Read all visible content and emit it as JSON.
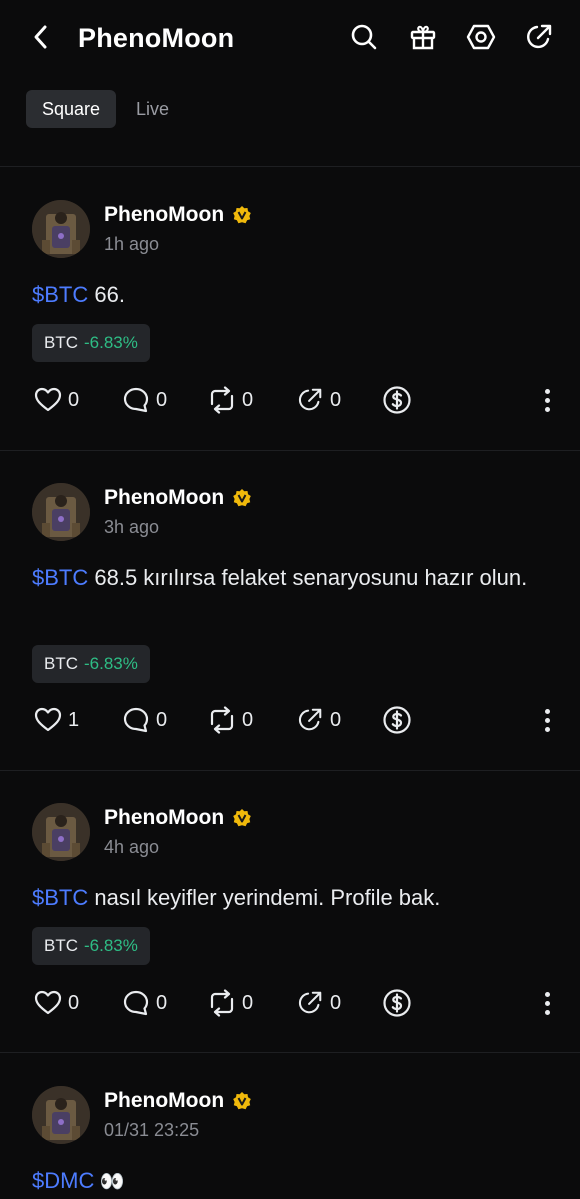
{
  "header": {
    "title": "PhenoMoon",
    "back_icon": "chevron-left-icon",
    "icons": [
      "search-icon",
      "gift-icon",
      "settings-icon",
      "share-icon"
    ]
  },
  "tabs": [
    {
      "label": "Square",
      "active": true
    },
    {
      "label": "Live",
      "active": false
    }
  ],
  "colors": {
    "background": "#0b0b0c",
    "cashtag": "#4d7cff",
    "positive_pct": "#2ebd85",
    "verified": "#f0b90b"
  },
  "posts": [
    {
      "author": "PhenoMoon",
      "time": "1h ago",
      "cashtag": "$BTC",
      "text": " 66.",
      "chip": {
        "symbol": "BTC",
        "change": "-6.83%"
      },
      "stats": {
        "likes": "0",
        "comments": "0",
        "reposts": "0",
        "shares": "0"
      }
    },
    {
      "author": "PhenoMoon",
      "time": "3h ago",
      "cashtag": "$BTC",
      "text": " 68.5 kırılırsa felaket senaryosunu hazır olun.",
      "chip": {
        "symbol": "BTC",
        "change": "-6.83%"
      },
      "stats": {
        "likes": "1",
        "comments": "0",
        "reposts": "0",
        "shares": "0"
      }
    },
    {
      "author": "PhenoMoon",
      "time": "4h ago",
      "cashtag": "$BTC",
      "text": " nasıl keyifler yerindemi. Profile bak.",
      "chip": {
        "symbol": "BTC",
        "change": "-6.83%"
      },
      "stats": {
        "likes": "0",
        "comments": "0",
        "reposts": "0",
        "shares": "0"
      }
    },
    {
      "author": "PhenoMoon",
      "time": "01/31 23:25",
      "cashtag": "$DMC",
      "text": " 👀"
    }
  ]
}
